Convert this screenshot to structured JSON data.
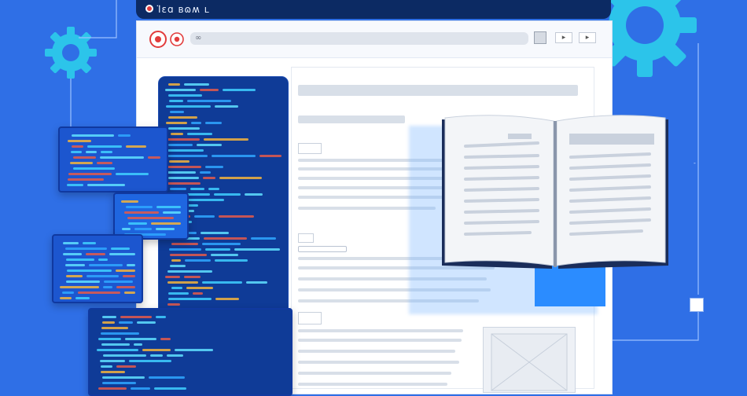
{
  "window": {
    "title": "Ⅰ̈ɛɑ ʙɷʍ ʟ",
    "address_text": "∞"
  },
  "colors": {
    "background": "#2f6fe6",
    "titlebar": "#0c2a63",
    "editor": "#0f3b97",
    "gear": "#2cc4ea",
    "accent_red": "#e23c3c",
    "book_page": "#f3f5f8"
  },
  "icons": {
    "gear_left": "gear-icon",
    "gear_right": "gear-icon",
    "book": "open-book-icon",
    "image_placeholder": "image-placeholder-icon"
  }
}
